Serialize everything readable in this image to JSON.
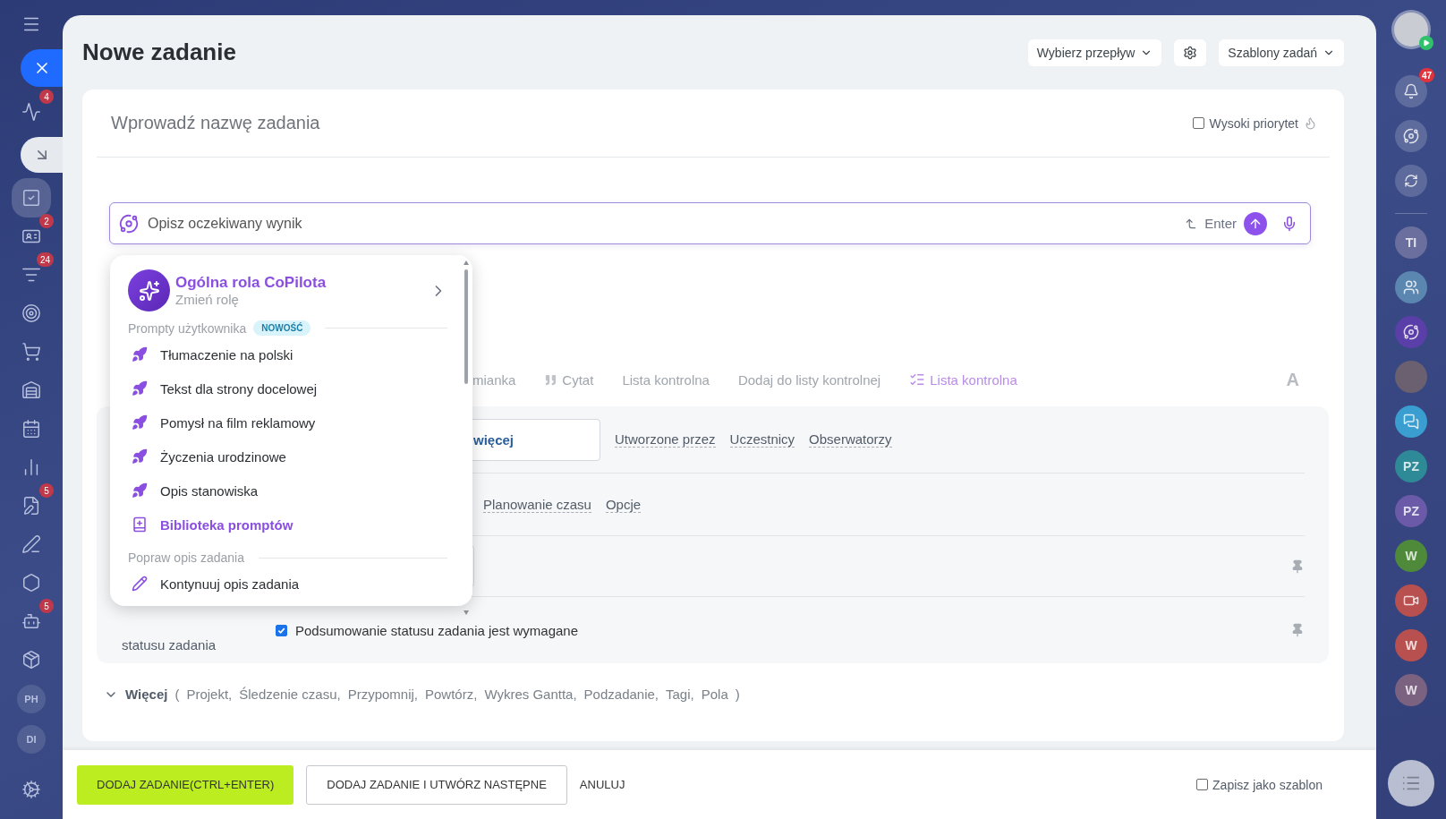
{
  "left_sidebar": {
    "items": [
      {
        "kind": "icon",
        "selected": false
      },
      {
        "kind": "icon",
        "selected": false,
        "badge": "4"
      },
      {
        "kind": "icon",
        "selected": true
      },
      {
        "kind": "icon",
        "selected": false,
        "badge": "2"
      },
      {
        "kind": "icon",
        "selected": false,
        "badge": "24"
      },
      {
        "kind": "icon",
        "selected": false
      },
      {
        "kind": "icon",
        "selected": false
      },
      {
        "kind": "icon",
        "selected": false
      },
      {
        "kind": "icon",
        "selected": false
      },
      {
        "kind": "icon",
        "selected": false
      },
      {
        "kind": "icon",
        "selected": false,
        "badge": "5"
      },
      {
        "kind": "icon",
        "selected": false
      },
      {
        "kind": "icon",
        "selected": false
      },
      {
        "kind": "icon",
        "selected": false,
        "badge": "5"
      },
      {
        "kind": "icon",
        "selected": false
      },
      {
        "kind": "initials",
        "selected": false,
        "label": "PH"
      },
      {
        "kind": "initials",
        "selected": false,
        "label": "DI"
      }
    ]
  },
  "window": {
    "title": "Nowe zadanie"
  },
  "header_actions": [
    {
      "kind": "dropdown",
      "label": "Wybierz przepływ"
    },
    {
      "kind": "icon"
    },
    {
      "kind": "dropdown",
      "label": "Szablony zadań"
    }
  ],
  "task": {
    "title_placeholder": "Wprowadź nazwę zadania",
    "high_priority": {
      "label": "Wysoki priorytet",
      "checked": false
    }
  },
  "copilot_input": {
    "placeholder": "Opisz oczekiwany wynik",
    "hint": "Enter"
  },
  "copilot_menu": {
    "role_title": "Ogólna rola CoPilota",
    "role_subtitle": "Zmień rolę",
    "sections": [
      {
        "title": "Prompty użytkownika",
        "badge": "NOWOŚĆ",
        "items": [
          {
            "kind": "prompt",
            "label": "Tłumaczenie na polski"
          },
          {
            "kind": "prompt",
            "label": "Tekst dla strony docelowej"
          },
          {
            "kind": "prompt",
            "label": "Pomysł na film reklamowy"
          },
          {
            "kind": "prompt",
            "label": "Życzenia urodzinowe"
          },
          {
            "kind": "prompt",
            "label": "Opis stanowiska"
          },
          {
            "kind": "library",
            "label": "Biblioteka promptów"
          }
        ]
      },
      {
        "title": "Popraw opis zadania",
        "items": [
          {
            "kind": "edit",
            "label": "Kontynuuj opis zadania"
          }
        ]
      }
    ]
  },
  "editor_toolbar": [
    {
      "kind": "text",
      "label": "mianka"
    },
    {
      "kind": "quote",
      "label": "Cytat"
    },
    {
      "kind": "text",
      "label": "Lista kontrolna"
    },
    {
      "kind": "text",
      "label": "Dodaj do listy kontrolnej"
    },
    {
      "kind": "copilot",
      "label": "Lista kontrolna"
    },
    {
      "kind": "format",
      "label": "A"
    }
  ],
  "fields": {
    "responsible_value": "więcej",
    "role_links": [
      "Utworzone przez",
      "Uczestnicy",
      "Obserwatorzy"
    ],
    "deadline_links": [
      "Planowanie czasu",
      "Opcje"
    ],
    "status_summary": {
      "label": "statusu zadania",
      "checkbox_label": "Podsumowanie statusu zadania jest wymagane",
      "checked": true
    }
  },
  "more": {
    "label": "Więcej",
    "open": "(",
    "items": [
      "Projekt,",
      "Śledzenie czasu,",
      "Przypomnij,",
      "Powtórz,",
      "Wykres Gantta,",
      "Podzadanie,",
      "Tagi,",
      "Pola"
    ],
    "close": ")"
  },
  "footer": {
    "buttons": [
      {
        "kind": "primary",
        "label": "DODAJ ZADANIE(CTRL+ENTER)"
      },
      {
        "kind": "secondary",
        "label": "DODAJ ZADANIE I UTWÓRZ NASTĘPNE"
      },
      {
        "kind": "link",
        "label": "ANULUJ"
      }
    ],
    "save_template": {
      "label": "Zapisz jako szablon",
      "checked": false
    }
  },
  "right_sidebar": {
    "notifications_badge": "47",
    "items": [
      {
        "kind": "initials",
        "label": "TI",
        "color": "#6a6f9e"
      },
      {
        "kind": "group",
        "color": "#5a86b0"
      },
      {
        "kind": "copilot",
        "color": "#5b3fa8"
      },
      {
        "kind": "photo",
        "color": "#6a6070"
      },
      {
        "kind": "chat",
        "color": "#3a9fd0"
      },
      {
        "kind": "initials",
        "label": "PZ",
        "color": "#2e8a96"
      },
      {
        "kind": "initials",
        "label": "PZ",
        "color": "#6a5aa8"
      },
      {
        "kind": "initials",
        "label": "W",
        "color": "#4e8a3a"
      },
      {
        "kind": "video",
        "color": "#b8504f"
      },
      {
        "kind": "initials",
        "label": "W",
        "color": "#b8504f"
      },
      {
        "kind": "initials",
        "label": "W",
        "color": "#7b6280"
      }
    ]
  }
}
